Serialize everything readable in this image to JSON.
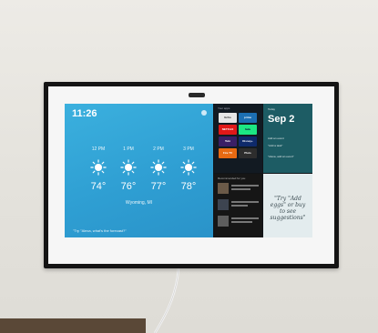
{
  "scene": {
    "device": "wall-mounted smart display",
    "colors": {
      "wall": "#e7e5df",
      "frame": "#141414",
      "mat": "#f6f6f6",
      "weather_bg": "#2f9fd3",
      "date_tile": "#1d5c64"
    }
  },
  "screen": {
    "time": "11:26",
    "forecast": [
      {
        "hour": "12 PM",
        "temp": "74°",
        "icon": "sun-icon"
      },
      {
        "hour": "1 PM",
        "temp": "76°",
        "icon": "sun-icon"
      },
      {
        "hour": "2 PM",
        "temp": "77°",
        "icon": "sun-icon"
      },
      {
        "hour": "3 PM",
        "temp": "78°",
        "icon": "sun-icon"
      }
    ],
    "location": "Wyoming, MI",
    "hint": "\"Try \"Alexa, what's the forecast?\"",
    "apps_tile": {
      "title": "Your apps",
      "apps": [
        {
          "label": "Echo",
          "color": "#e7e7e7"
        },
        {
          "label": "prime",
          "color": "#1c6fb3"
        },
        {
          "label": "NETFLIX",
          "color": "#e01818"
        },
        {
          "label": "hulu",
          "color": "#1ce783"
        },
        {
          "label": "Tubi",
          "color": "#3a1f66"
        },
        {
          "label": "Disney+",
          "color": "#0e2a6b"
        },
        {
          "label": "Fire TV",
          "color": "#e86a12"
        },
        {
          "label": "Pluto",
          "color": "#2d2d2d"
        }
      ]
    },
    "date_tile": {
      "day": "Today",
      "date": "Sep 2",
      "lines": [
        "Add an event",
        "\"Add a task\"",
        "\"Alexa, add an event\""
      ]
    },
    "recommended": {
      "title": "Recommended for you"
    },
    "tip": {
      "text": "\"Try \"Add eggs\" or buy to see suggestions\""
    }
  }
}
